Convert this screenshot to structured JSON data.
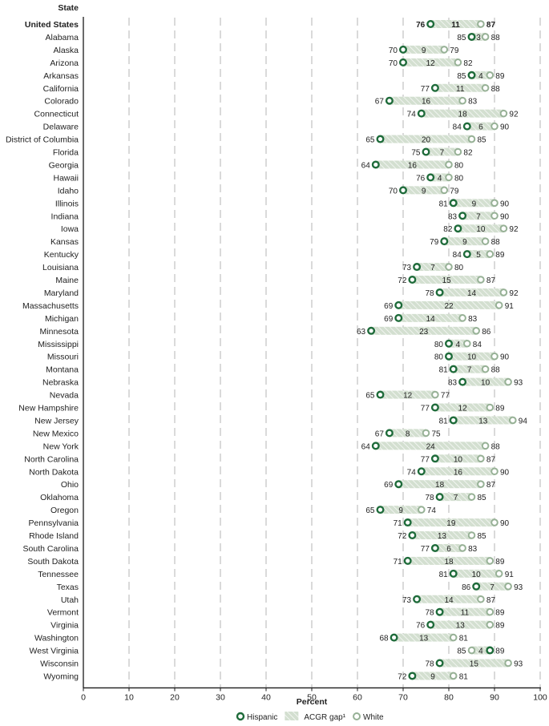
{
  "chart_data": {
    "type": "dumbbell",
    "title": "",
    "row_header": "State",
    "xlabel": "Percent",
    "ylabel": "State",
    "xlim": [
      0,
      100
    ],
    "xticks": [
      0,
      10,
      20,
      30,
      40,
      50,
      60,
      70,
      80,
      90,
      100
    ],
    "grid": "vertical dashed",
    "legend_placement": "bottom-center",
    "legend": [
      {
        "key": "hispanic",
        "label": "Hispanic",
        "marker": "circle-dark"
      },
      {
        "key": "gap",
        "label": "ACGR gap¹",
        "marker": "hatched-bar"
      },
      {
        "key": "white",
        "label": "White",
        "marker": "circle-light"
      }
    ],
    "colors": {
      "hispanic": "#1e6b3a",
      "white": "#97b196",
      "gap_fill": "#d3dfd0",
      "gap_hatch": "#ffffff",
      "grid": "#b5b5b5",
      "axis": "#1a1a1a"
    },
    "rows": [
      {
        "state": "United States",
        "hispanic": 76,
        "white": 87,
        "gap": 11,
        "emphasis": true
      },
      {
        "state": "Alabama",
        "hispanic": 85,
        "white": 88,
        "gap": 3
      },
      {
        "state": "Alaska",
        "hispanic": 70,
        "white": 79,
        "gap": 9
      },
      {
        "state": "Arizona",
        "hispanic": 70,
        "white": 82,
        "gap": 12
      },
      {
        "state": "Arkansas",
        "hispanic": 85,
        "white": 89,
        "gap": 4
      },
      {
        "state": "California",
        "hispanic": 77,
        "white": 88,
        "gap": 11
      },
      {
        "state": "Colorado",
        "hispanic": 67,
        "white": 83,
        "gap": 16
      },
      {
        "state": "Connecticut",
        "hispanic": 74,
        "white": 92,
        "gap": 18
      },
      {
        "state": "Delaware",
        "hispanic": 84,
        "white": 90,
        "gap": 6
      },
      {
        "state": "District of Columbia",
        "hispanic": 65,
        "white": 85,
        "gap": 20
      },
      {
        "state": "Florida",
        "hispanic": 75,
        "white": 82,
        "gap": 7
      },
      {
        "state": "Georgia",
        "hispanic": 64,
        "white": 80,
        "gap": 16
      },
      {
        "state": "Hawaii",
        "hispanic": 76,
        "white": 80,
        "gap": 4
      },
      {
        "state": "Idaho",
        "hispanic": 70,
        "white": 79,
        "gap": 9
      },
      {
        "state": "Illinois",
        "hispanic": 81,
        "white": 90,
        "gap": 9
      },
      {
        "state": "Indiana",
        "hispanic": 83,
        "white": 90,
        "gap": 7
      },
      {
        "state": "Iowa",
        "hispanic": 82,
        "white": 92,
        "gap": 10
      },
      {
        "state": "Kansas",
        "hispanic": 79,
        "white": 88,
        "gap": 9
      },
      {
        "state": "Kentucky",
        "hispanic": 84,
        "white": 89,
        "gap": 5
      },
      {
        "state": "Louisiana",
        "hispanic": 73,
        "white": 80,
        "gap": 7
      },
      {
        "state": "Maine",
        "hispanic": 72,
        "white": 87,
        "gap": 15
      },
      {
        "state": "Maryland",
        "hispanic": 78,
        "white": 92,
        "gap": 14
      },
      {
        "state": "Massachusetts",
        "hispanic": 69,
        "white": 91,
        "gap": 22
      },
      {
        "state": "Michigan",
        "hispanic": 69,
        "white": 83,
        "gap": 14
      },
      {
        "state": "Minnesota",
        "hispanic": 63,
        "white": 86,
        "gap": 23
      },
      {
        "state": "Mississippi",
        "hispanic": 80,
        "white": 84,
        "gap": 4
      },
      {
        "state": "Missouri",
        "hispanic": 80,
        "white": 90,
        "gap": 10
      },
      {
        "state": "Montana",
        "hispanic": 81,
        "white": 88,
        "gap": 7
      },
      {
        "state": "Nebraska",
        "hispanic": 83,
        "white": 93,
        "gap": 10
      },
      {
        "state": "Nevada",
        "hispanic": 65,
        "white": 77,
        "gap": 12
      },
      {
        "state": "New Hampshire",
        "hispanic": 77,
        "white": 89,
        "gap": 12
      },
      {
        "state": "New Jersey",
        "hispanic": 81,
        "white": 94,
        "gap": 13
      },
      {
        "state": "New Mexico",
        "hispanic": 67,
        "white": 75,
        "gap": 8
      },
      {
        "state": "New York",
        "hispanic": 64,
        "white": 88,
        "gap": 24
      },
      {
        "state": "North Carolina",
        "hispanic": 77,
        "white": 87,
        "gap": 10
      },
      {
        "state": "North Dakota",
        "hispanic": 74,
        "white": 90,
        "gap": 16
      },
      {
        "state": "Ohio",
        "hispanic": 69,
        "white": 87,
        "gap": 18
      },
      {
        "state": "Oklahoma",
        "hispanic": 78,
        "white": 85,
        "gap": 7
      },
      {
        "state": "Oregon",
        "hispanic": 65,
        "white": 74,
        "gap": 9
      },
      {
        "state": "Pennsylvania",
        "hispanic": 71,
        "white": 90,
        "gap": 19
      },
      {
        "state": "Rhode Island",
        "hispanic": 72,
        "white": 85,
        "gap": 13
      },
      {
        "state": "South Carolina",
        "hispanic": 77,
        "white": 83,
        "gap": 6
      },
      {
        "state": "South Dakota",
        "hispanic": 71,
        "white": 89,
        "gap": 18
      },
      {
        "state": "Tennessee",
        "hispanic": 81,
        "white": 91,
        "gap": 10
      },
      {
        "state": "Texas",
        "hispanic": 86,
        "white": 93,
        "gap": 7
      },
      {
        "state": "Utah",
        "hispanic": 73,
        "white": 87,
        "gap": 14
      },
      {
        "state": "Vermont",
        "hispanic": 78,
        "white": 89,
        "gap": 11
      },
      {
        "state": "Virginia",
        "hispanic": 76,
        "white": 89,
        "gap": 13
      },
      {
        "state": "Washington",
        "hispanic": 68,
        "white": 81,
        "gap": 13
      },
      {
        "state": "West Virginia",
        "hispanic": 89,
        "white": 85,
        "gap": 4
      },
      {
        "state": "Wisconsin",
        "hispanic": 78,
        "white": 93,
        "gap": 15
      },
      {
        "state": "Wyoming",
        "hispanic": 72,
        "white": 81,
        "gap": 9
      }
    ]
  }
}
